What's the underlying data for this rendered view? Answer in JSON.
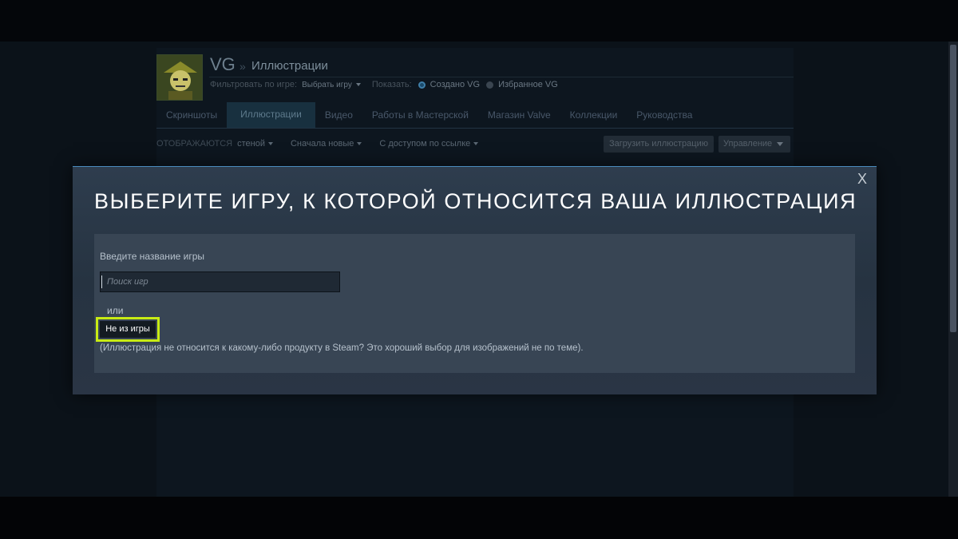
{
  "profile": {
    "name": "VG",
    "separator": "»",
    "section": "Иллюстрации"
  },
  "filter": {
    "label": "Фильтровать по игре:",
    "game_select": "Выбрать игру",
    "show_label": "Показать:",
    "radio_created": "Создано VG",
    "radio_favorites": "Избранное VG"
  },
  "tabs": [
    {
      "label": "Скриншоты"
    },
    {
      "label": "Иллюстрации"
    },
    {
      "label": "Видео"
    },
    {
      "label": "Работы в Мастерской"
    },
    {
      "label": "Магазин Valve"
    },
    {
      "label": "Коллекции"
    },
    {
      "label": "Руководства"
    }
  ],
  "options": {
    "display_label": "ОТОБРАЖАЮТСЯ",
    "display_value": "стеной",
    "sort_value": "Сначала новые",
    "access_value": "С доступом по ссылке",
    "upload_label": "Загрузить иллюстрацию",
    "manage_label": "Управление"
  },
  "modal": {
    "close_label": "X",
    "title": "ВЫБЕРИТЕ ИГРУ, К КОТОРОЙ ОТНОСИТСЯ ВАША ИЛЛЮСТРАЦИЯ",
    "enter_label": "Введите название игры",
    "search_placeholder": "Поиск игр",
    "or_label": "или",
    "not_game_button": "Не из игры",
    "note": "(Иллюстрация не относится к какому-либо продукту в Steam? Это хороший выбор для изображений не по теме)."
  },
  "colors": {
    "highlight": "#c8eb14",
    "modal_accent": "#4a8bbd"
  }
}
